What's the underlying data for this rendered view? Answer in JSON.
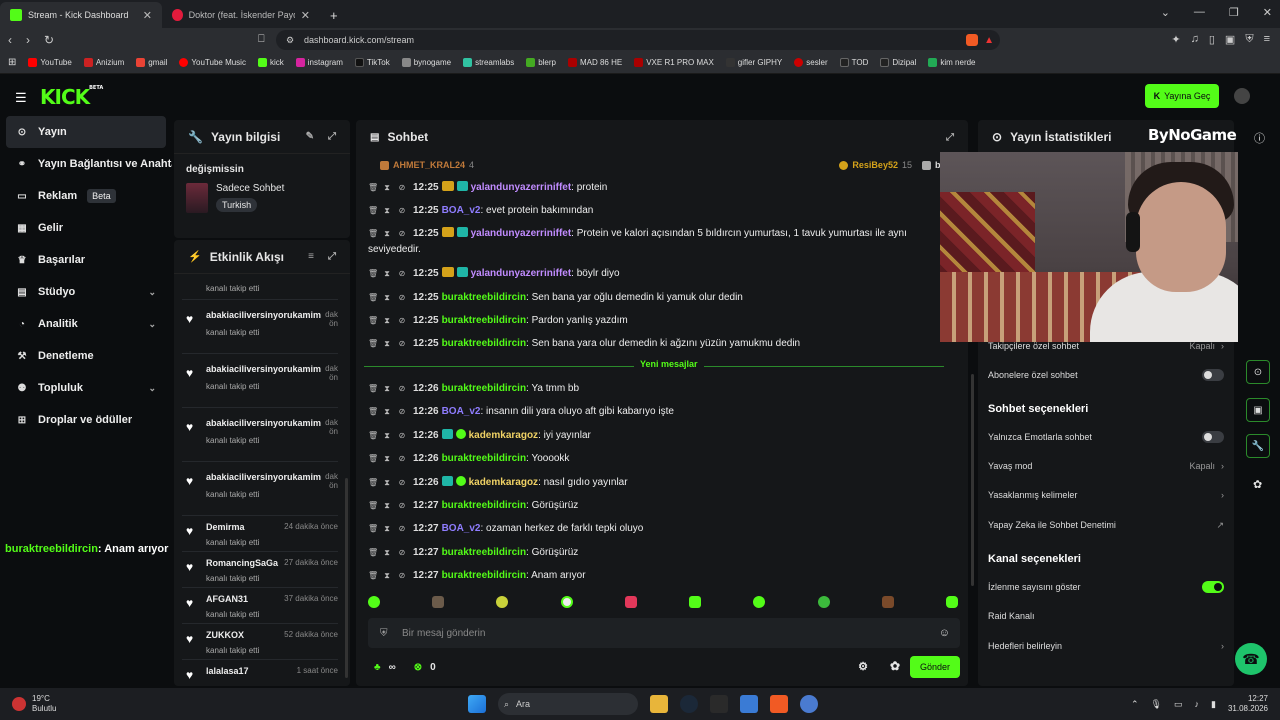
{
  "browser": {
    "tabs": [
      {
        "label": "Stream - Kick Dashboard",
        "active": true
      },
      {
        "label": "Doktor (feat. İskender Paydaş) | Yo",
        "active": false
      }
    ],
    "url": "dashboard.kick.com/stream",
    "bookmarks": [
      "YouTube",
      "Anizium",
      "gmail",
      "YouTube Music",
      "kick",
      "instagram",
      "TikTok",
      "bynogame",
      "streamlabs",
      "blerp",
      "MAD 86 HE",
      "VXE R1 PRO MAX",
      "gifler GIPHY",
      "sesler",
      "TOD",
      "Dizipal",
      "kim nerde"
    ]
  },
  "header": {
    "logo": "KICK",
    "logo_badge": "BETA",
    "go_live": "Yayına Geç"
  },
  "sidebar": {
    "items": [
      {
        "label": "Yayın",
        "icon": "radio-icon"
      },
      {
        "label": "Yayın Bağlantısı ve Anahtar",
        "icon": "link-icon"
      },
      {
        "label": "Reklam",
        "icon": "ad-icon",
        "badge": "Beta"
      },
      {
        "label": "Gelir",
        "icon": "money-icon"
      },
      {
        "label": "Başarılar",
        "icon": "trophy-icon"
      },
      {
        "label": "Stüdyo",
        "icon": "studio-icon"
      },
      {
        "label": "Analitik",
        "icon": "chart-icon"
      },
      {
        "label": "Denetleme",
        "icon": "hammer-icon"
      },
      {
        "label": "Topluluk",
        "icon": "users-icon"
      },
      {
        "label": "Droplar ve ödüller",
        "icon": "gift-icon"
      }
    ]
  },
  "overlay_chat": {
    "user": "buraktreebildircin",
    "text": ": Anam arıyor"
  },
  "info_panel": {
    "title": "Yayın bilgisi",
    "stream_title": "değişmissin",
    "category": "Sadece Sohbet",
    "tag": "Turkish"
  },
  "activity": {
    "title": "Etkinlik Akışı",
    "top_sub": "kanalı takip etti",
    "items": [
      {
        "name": "abakiaciliversinyorukamim",
        "time": "dak\nön",
        "sub": "kanalı takip etti"
      },
      {
        "name": "abakiaciliversinyorukamim",
        "time": "dak\nön",
        "sub": "kanalı takip etti"
      },
      {
        "name": "abakiaciliversinyorukamim",
        "time": "dak\nön",
        "sub": "kanalı takip etti"
      },
      {
        "name": "abakiaciliversinyorukamim",
        "time": "dak\nön",
        "sub": "kanalı takip etti"
      },
      {
        "name": "Demirma",
        "time": "24 dakika önce",
        "sub": "kanalı takip etti"
      },
      {
        "name": "RomancingSaGa",
        "time": "27 dakika önce",
        "sub": "kanalı takip etti"
      },
      {
        "name": "AFGAN31",
        "time": "37 dakika önce",
        "sub": "kanalı takip etti"
      },
      {
        "name": "ZUKKOX",
        "time": "52 dakika önce",
        "sub": "kanalı takip etti"
      },
      {
        "name": "lalalasa17",
        "time": "1 saat önce",
        "sub": ""
      }
    ]
  },
  "chat": {
    "title": "Sohbet",
    "pinned": [
      {
        "name": "AHMET_KRAL24",
        "count": "4"
      },
      {
        "name": "ResiBey52",
        "count": "15"
      },
      {
        "name": "babyoda",
        "count": ""
      }
    ],
    "messages_before": [
      {
        "time": "12:25",
        "user": "yalandunyazerriniffet",
        "color": "#c18cff",
        "crown": true,
        "sub": true,
        "text": "protein"
      },
      {
        "time": "12:25",
        "user": "BOA_v2",
        "color": "#8f7dff",
        "crown": false,
        "sub": false,
        "text": "evet protein bakımından"
      },
      {
        "time": "12:25",
        "user": "yalandunyazerriniffet",
        "color": "#c18cff",
        "crown": true,
        "sub": true,
        "text": "Protein ve kalori açısından 5 bıldırcın yumurtası, 1 tavuk yumurtası ile aynı seviyededir."
      },
      {
        "time": "12:25",
        "user": "yalandunyazerriniffet",
        "color": "#c18cff",
        "crown": true,
        "sub": true,
        "text": "böylr diyo"
      },
      {
        "time": "12:25",
        "user": "buraktreebildircin",
        "color": "#53fc18",
        "crown": false,
        "sub": false,
        "text": "Sen bana yar oğlu demedin ki yamuk olur dedin"
      },
      {
        "time": "12:25",
        "user": "buraktreebildircin",
        "color": "#53fc18",
        "crown": false,
        "sub": false,
        "text": "Pardon yanlış yazdım"
      },
      {
        "time": "12:25",
        "user": "buraktreebildircin",
        "color": "#53fc18",
        "crown": false,
        "sub": false,
        "text": "Sen bana yara olur demedin ki ağzını yüzün yamukmu dedin"
      }
    ],
    "new_messages_label": "Yeni mesajlar",
    "messages_after": [
      {
        "time": "12:26",
        "user": "buraktreebildircin",
        "color": "#53fc18",
        "badges": "",
        "text": "Ya tmm bb"
      },
      {
        "time": "12:26",
        "user": "BOA_v2",
        "color": "#8f7dff",
        "badges": "",
        "text": "insanın dili yara oluyo aft gibi kabarıyo işte"
      },
      {
        "time": "12:26",
        "user": "kademkaragoz",
        "color": "#f0d265",
        "badges": "sub-verified",
        "text": "iyi yayınlar"
      },
      {
        "time": "12:26",
        "user": "buraktreebildircin",
        "color": "#53fc18",
        "badges": "",
        "text": "Yooookk"
      },
      {
        "time": "12:26",
        "user": "kademkaragoz",
        "color": "#f0d265",
        "badges": "sub-verified",
        "text": "nasıl gıdıo yayınlar"
      },
      {
        "time": "12:27",
        "user": "buraktreebildircin",
        "color": "#53fc18",
        "badges": "",
        "text": "Görüşürüz"
      },
      {
        "time": "12:27",
        "user": "BOA_v2",
        "color": "#8f7dff",
        "badges": "",
        "text": "ozaman herkez de farklı tepki oluyo"
      },
      {
        "time": "12:27",
        "user": "buraktreebildircin",
        "color": "#53fc18",
        "badges": "",
        "text": "Görüşürüz"
      },
      {
        "time": "12:27",
        "user": "buraktreebildircin",
        "color": "#53fc18",
        "badges": "",
        "text": "Anam arıyor"
      }
    ],
    "input_placeholder": "Bir mesaj gönderin",
    "infinity_label": "∞",
    "points": "0",
    "send_label": "Gönder"
  },
  "stats": {
    "title": "Yayın İstatistikleri",
    "brand": "ByNoGame",
    "rows": [
      {
        "label": "Takipçilere özel sohbet",
        "value": "Kapalı",
        "kind": "chevron"
      },
      {
        "label": "Abonelere özel sohbet",
        "value": "",
        "kind": "toggle-off"
      }
    ],
    "section_chat": "Sohbet seçenekleri",
    "chat_rows": [
      {
        "label": "Yalnızca Emotlarla sohbet",
        "value": "",
        "kind": "toggle-off"
      },
      {
        "label": "Yavaş mod",
        "value": "Kapalı",
        "kind": "chevron"
      },
      {
        "label": "Yasaklanmış kelimeler",
        "value": "",
        "kind": "chevron"
      },
      {
        "label": "Yapay Zeka ile Sohbet Denetimi",
        "value": "",
        "kind": "external"
      }
    ],
    "section_channel": "Kanal seçenekleri",
    "channel_rows": [
      {
        "label": "İzlenme sayısını göster",
        "value": "",
        "kind": "toggle-on"
      },
      {
        "label": "Raid Kanalı",
        "value": "",
        "kind": "none"
      },
      {
        "label": "Hedefleri belirleyin",
        "value": "",
        "kind": "chevron"
      }
    ]
  },
  "taskbar": {
    "temp": "19°C",
    "weather": "Bulutlu",
    "search": "Ara",
    "time": "12:27",
    "date": "31.08.2026"
  }
}
